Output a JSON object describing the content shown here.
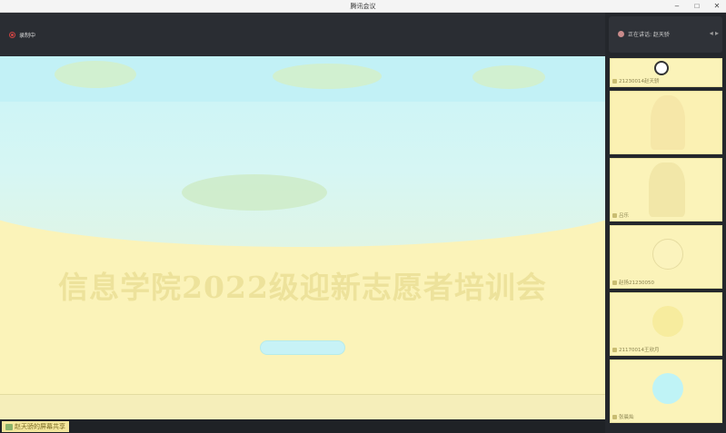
{
  "window": {
    "title": "腾讯会议"
  },
  "window_controls": {
    "minimize": "–",
    "maximize": "□",
    "close": "✕"
  },
  "topbar": {
    "recording_label": "录制中"
  },
  "slide": {
    "title": "信息学院2022级迎新志愿者培训会"
  },
  "share": {
    "label": "赵天骄的屏幕共享"
  },
  "right_panel": {
    "speaking_label": "正在讲话: 赵天骄",
    "participants": [
      {
        "name": "21230014赵天骄"
      },
      {
        "name": ""
      },
      {
        "name": "吕乐"
      },
      {
        "name": "赵扬21230050"
      },
      {
        "name": "21170014王欣月"
      },
      {
        "name": "张晨灿"
      }
    ]
  },
  "colors": {
    "slide_bg": "#fbf3b9",
    "sky": "#c9f4f7",
    "title": "#ede29b",
    "panel": "#24272c"
  }
}
